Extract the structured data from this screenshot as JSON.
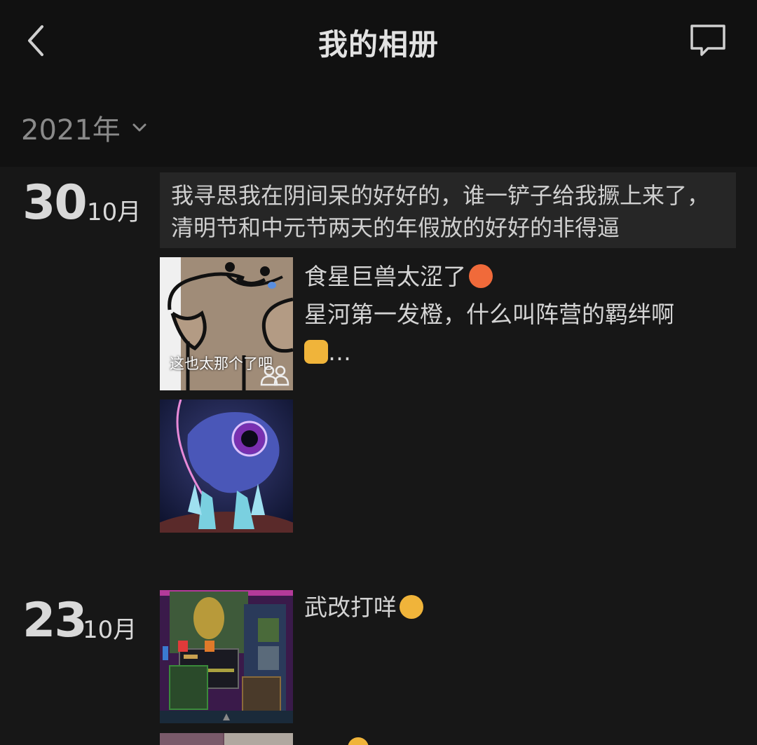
{
  "header": {
    "title": "我的相册",
    "back_icon": "back-arrow-icon",
    "message_icon": "message-bubble-icon"
  },
  "filter": {
    "year_label": "2021年"
  },
  "entries": [
    {
      "day": "30",
      "month": "10月",
      "text_post": "我寻思我在阴间呆的好好的，谁一铲子给我撅上来了，清明节和中元节两天的年假放的好好的非得逼",
      "photo_post": {
        "caption_line1": "食星巨兽太涩了",
        "caption_line2": "星河第一发橙，什么叫阵营的羁绊啊",
        "caption_line3": "…",
        "thumb1_overlay_text": "这也太那个了吧"
      }
    },
    {
      "day": "23",
      "month": "10月",
      "photo_post": {
        "caption": "武改打咩"
      }
    }
  ],
  "colors": {
    "background": "#171717",
    "header_bg": "#111111",
    "text_post_bg": "#262626"
  }
}
